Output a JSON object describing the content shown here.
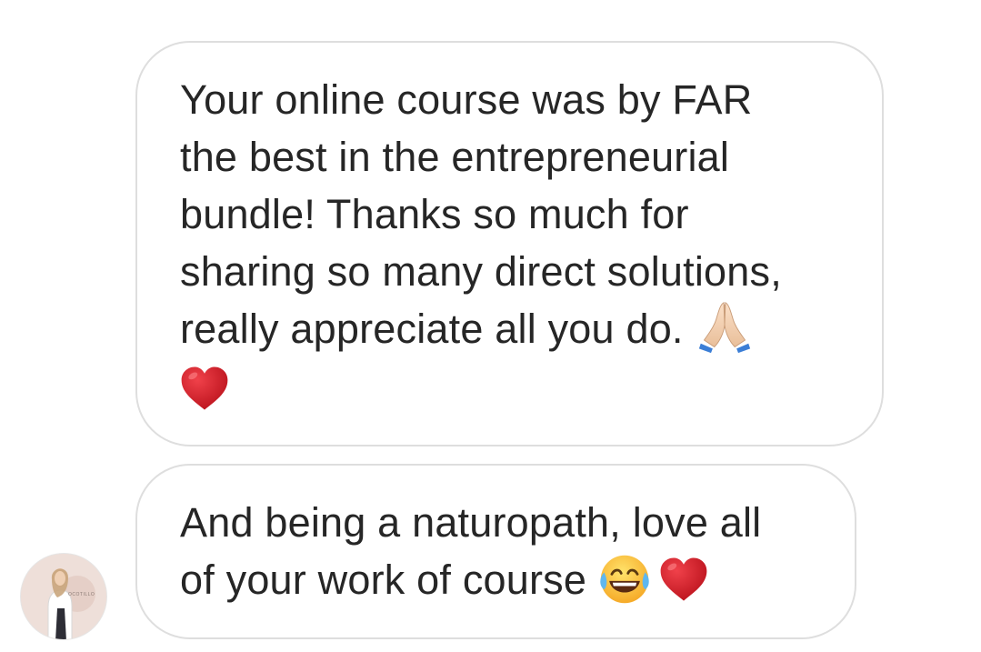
{
  "messages": [
    {
      "text": "Your online course was by FAR\nthe best in the entrepreneurial\nbundle! Thanks so much for\nsharing so many direct solutions,\nreally appreciate all you do.",
      "emojis": [
        "folded-hands",
        "red-heart"
      ]
    },
    {
      "text": "And being a naturopath, love all\nof your work of course",
      "emojis": [
        "tears-of-joy-face",
        "red-heart"
      ]
    }
  ],
  "avatar": {
    "logo_text": "OCOTILLO"
  },
  "colors": {
    "bubble_border": "#dedede",
    "text": "#262626",
    "heart": "#d6141f",
    "background": "#ffffff"
  }
}
